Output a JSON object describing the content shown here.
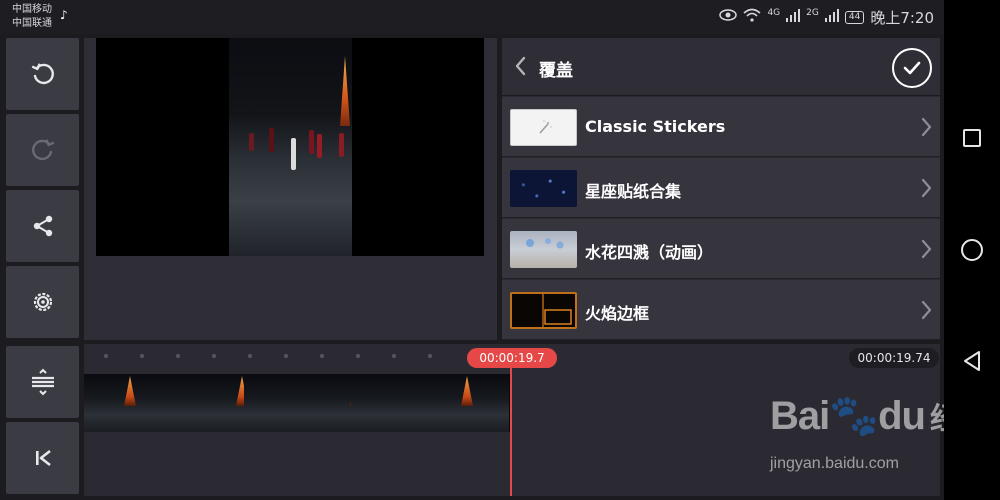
{
  "status_bar": {
    "carrier_1": "中国移动",
    "carrier_2": "中国联通",
    "network_1": "4G",
    "network_2": "2G",
    "battery": "44",
    "time": "晚上7:20"
  },
  "overlay_panel": {
    "title": "覆盖",
    "items": [
      {
        "label": "Classic Stickers"
      },
      {
        "label": "星座贴纸合集"
      },
      {
        "label": "水花四溅（动画）"
      },
      {
        "label": "火焰边框"
      }
    ]
  },
  "timeline": {
    "playhead_time": "00:00:19.7",
    "total_duration": "00:00:19.74"
  },
  "watermark": {
    "logo": "Bai",
    "logo_cn": "经验",
    "url": "jingyan.baidu.com"
  },
  "colors": {
    "accent_red": "#e64848",
    "panel": "#36353e",
    "toolbar_button": "#3b3b44"
  }
}
